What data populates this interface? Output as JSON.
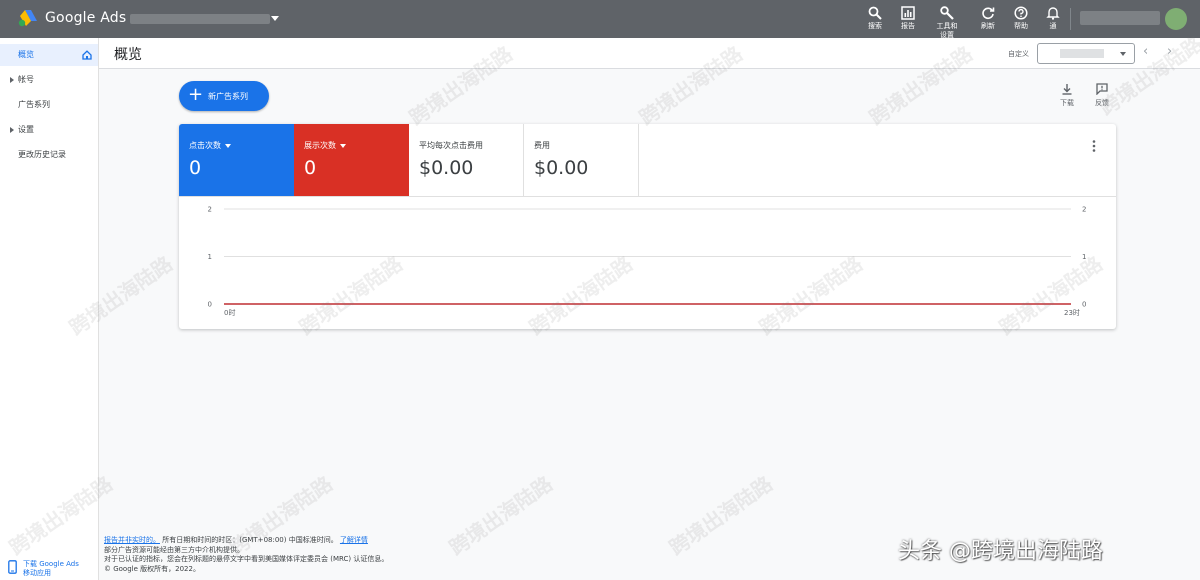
{
  "app": {
    "name": "Google Ads"
  },
  "toolbar": [
    {
      "icon": "search-icon",
      "label": "搜索"
    },
    {
      "icon": "reports-icon",
      "label": "报告"
    },
    {
      "icon": "tools-icon",
      "label": "工具和设置"
    },
    {
      "icon": "refresh-icon",
      "label": "刷新"
    },
    {
      "icon": "help-icon",
      "label": "帮助"
    },
    {
      "icon": "bell-icon",
      "label": "通"
    }
  ],
  "sidebar": {
    "items": [
      {
        "label": "概览",
        "active": true
      },
      {
        "label": "帐号",
        "expandable": true
      },
      {
        "label": "广告系列"
      },
      {
        "label": "设置",
        "expandable": true
      },
      {
        "label": "更改历史记录"
      }
    ],
    "app_download": {
      "line1": "下载 Google Ads",
      "line2": "移动应用"
    }
  },
  "header": {
    "title": "概览",
    "date_range_label": "自定义",
    "prev_icon": "chevron-left-icon",
    "next_icon": "chevron-right-icon"
  },
  "new_campaign": {
    "label": "新广告系列"
  },
  "actions": {
    "download": "下载",
    "feedback": "反馈"
  },
  "metrics": [
    {
      "label": "点击次数",
      "value": "0",
      "color": "#1a73e8",
      "dropdown": true
    },
    {
      "label": "展示次数",
      "value": "0",
      "color": "#d93025",
      "dropdown": true
    },
    {
      "label": "平均每次点击费用",
      "value": "$0.00"
    },
    {
      "label": "费用",
      "value": "$0.00"
    }
  ],
  "chart_data": {
    "type": "line",
    "x_tick_labels": [
      "0时",
      "23时"
    ],
    "y_left_ticks": [
      0,
      1,
      2
    ],
    "y_right_ticks": [
      0,
      1,
      2
    ],
    "ylim": [
      0,
      2
    ],
    "x": [
      0,
      23
    ],
    "series": [
      {
        "color": "#d93025",
        "values": [
          0,
          0
        ]
      },
      {
        "color": "#1a73e8",
        "values": [
          0,
          0
        ]
      }
    ],
    "grid": true
  },
  "footer": {
    "link1": "报告并非实时的。",
    "text1": "所有日期和时间的时区：(GMT+08:00) 中国标准时间。",
    "link2": "了解详情",
    "line2": "部分广告资源可能经由第三方中介机构提供。",
    "line3": "对于已认证的指标，您会在列标题的悬停文字中看到美国媒体评定委员会 (MRC) 认证信息。",
    "line4": "© Google 版权所有，2022。"
  },
  "watermark": "跨境出海陆路",
  "credit": "头条 @跨境出海陆路"
}
